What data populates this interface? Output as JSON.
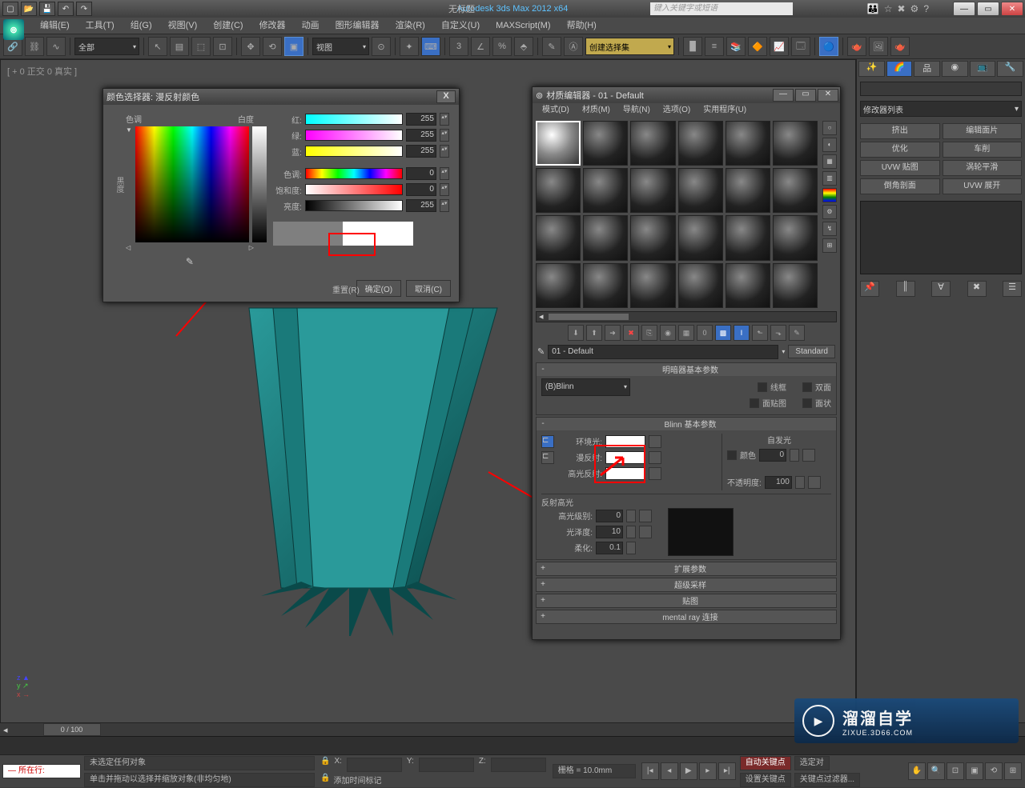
{
  "titlebar": {
    "app_title": "Autodesk 3ds Max 2012 x64",
    "doc_title": "无标题",
    "search_placeholder": "键入关键字或短语"
  },
  "menubar": [
    "编辑(E)",
    "工具(T)",
    "组(G)",
    "视图(V)",
    "创建(C)",
    "修改器",
    "动画",
    "图形编辑器",
    "渲染(R)",
    "自定义(U)",
    "MAXScript(M)",
    "帮助(H)"
  ],
  "toolbar": {
    "sel_all": "全部",
    "view_sel": "视图",
    "cmd_sel": "创建选择集"
  },
  "viewport_label": "[ + 0 正交 0 真实 ]",
  "cmdpanel": {
    "mod_list": "修改器列表",
    "btns": [
      "挤出",
      "编辑面片",
      "优化",
      "车削",
      "UVW 贴图",
      "涡轮平滑",
      "倒角剖面",
      "UVW 展开"
    ]
  },
  "color_picker": {
    "title": "颜色选择器: 漫反射颜色",
    "hue_lbl": "色调",
    "white_lbl": "白度",
    "black_lbl": "黑度",
    "red": "红:",
    "green": "绿:",
    "blue": "蓝:",
    "hue2": "色调:",
    "sat": "饱和度:",
    "val": "亮度:",
    "r": "255",
    "g": "255",
    "b": "255",
    "h": "0",
    "s": "0",
    "v": "255",
    "reset": "重置(R)",
    "ok": "确定(O)",
    "cancel": "取消(C)"
  },
  "mat": {
    "title": "材质编辑器 - 01 - Default",
    "menu": [
      "模式(D)",
      "材质(M)",
      "导航(N)",
      "选项(O)",
      "实用程序(U)"
    ],
    "name": "01 - Default",
    "type_btn": "Standard",
    "rollouts": {
      "shader": {
        "title": "明暗器基本参数",
        "blinn": "(B)Blinn",
        "wire": "线框",
        "two": "双面",
        "facemap": "面贴图",
        "faceted": "面状"
      },
      "basic": {
        "title": "Blinn 基本参数",
        "ambient": "环境光:",
        "diffuse": "漫反射:",
        "spec": "高光反射:",
        "selfillum": "自发光",
        "color_chk": "颜色",
        "selfillum_val": "0",
        "opacity": "不透明度:",
        "opacity_val": "100",
        "spec_hilite": "反射高光",
        "spec_level": "高光级别:",
        "spec_level_val": "0",
        "gloss": "光泽度:",
        "gloss_val": "10",
        "soften": "柔化:",
        "soften_val": "0.1"
      },
      "ext": "扩展参数",
      "super": "超级采样",
      "maps": "贴图",
      "mental": "mental ray 连接"
    }
  },
  "timeline": {
    "frame": "0 / 100"
  },
  "status": {
    "noobj": "未选定任何对象",
    "hint": "单击并拖动以选择并缩放对象(非均匀地)",
    "grid": "栅格 = 10.0mm",
    "autokey": "自动关键点",
    "selset": "选定对",
    "setkey": "设置关键点",
    "keyfilter": "关键点过滤器...",
    "addtime": "添加时间标记",
    "script": "所在行:"
  },
  "watermark": {
    "big": "溜溜自学",
    "sm": "ZIXUE.3D66.COM"
  }
}
